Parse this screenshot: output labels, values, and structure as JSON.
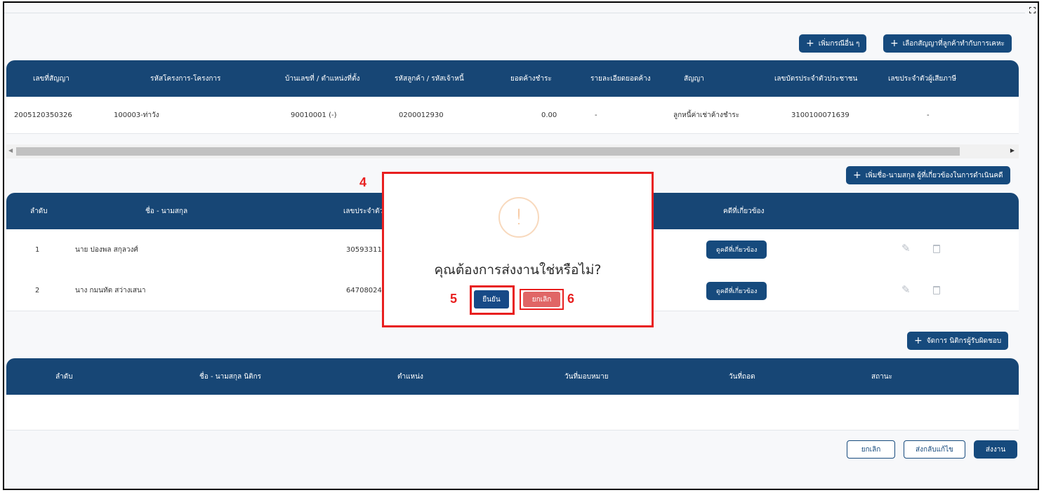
{
  "top_buttons": {
    "add_other": "เพิ่มกรณีอื่น ๆ",
    "select_contract": "เลือกสัญญาที่ลูกค้าทำกับการเคหะ"
  },
  "contracts_table": {
    "headers": [
      "เลขที่สัญญา",
      "รหัสโครงการ-โครงการ",
      "บ้านเลขที่ / ตำแหน่งที่ตั้ง",
      "รหัสลูกค้า / รหัสเจ้าหนี้",
      "ยอดค้างชำระ",
      "รายละเอียดยอดค้าง",
      "สัญญา",
      "เลขบัตรประจำตัวประชาชน",
      "เลขประจำตัวผู้เสียภาษี"
    ],
    "rows": [
      [
        "2005120350326",
        "100003-ท่าวัง",
        "90010001 (-)",
        "0200012930",
        "0.00",
        "-",
        "ลูกหนี้ค่าเช่าค้างชำระ",
        "3100100071639",
        "-"
      ]
    ]
  },
  "persons_section": {
    "add_button": "เพิ่มชื่อ-นามสกุล ผู้ที่เกี่ยวข้องในการดำเนินคดี",
    "headers": [
      "ลำดับ",
      "ชื่อ - นามสกุล",
      "เลขประจำตัว",
      "คดีที่เกี่ยวข้อง"
    ],
    "rows": [
      {
        "no": "1",
        "name": "นาย ปองพล สกุลวงศ์",
        "id": "305933115",
        "case_button": "ดูคดีที่เกี่ยวข้อง"
      },
      {
        "no": "2",
        "name": "นาง กมนทัต สว่างเสนา",
        "id": "64708024",
        "case_button": "ดูคดีที่เกี่ยวข้อง"
      }
    ]
  },
  "lawyer_section": {
    "manage_button": "จัดการ นิติกรผู้รับผิดชอบ",
    "headers": [
      "ลำดับ",
      "ชื่อ - นามสกุล นิติกร",
      "ตำแหน่ง",
      "วันที่มอบหมาย",
      "วันที่ถอด",
      "สถานะ"
    ]
  },
  "footer_buttons": {
    "cancel": "ยกเลิก",
    "send_back": "ส่งกลับแก้ไข",
    "submit": "ส่งงาน"
  },
  "modal": {
    "icon_text": "!",
    "message": "คุณต้องการส่งงานใช่หรือไม่?",
    "confirm": "ยืนยัน",
    "cancel": "ยกเลิก"
  },
  "callouts": {
    "c4": "4",
    "c5": "5",
    "c6": "6"
  },
  "colors": {
    "navy": "#174675",
    "danger": "#e06666",
    "annotation": "#e81f1f"
  }
}
